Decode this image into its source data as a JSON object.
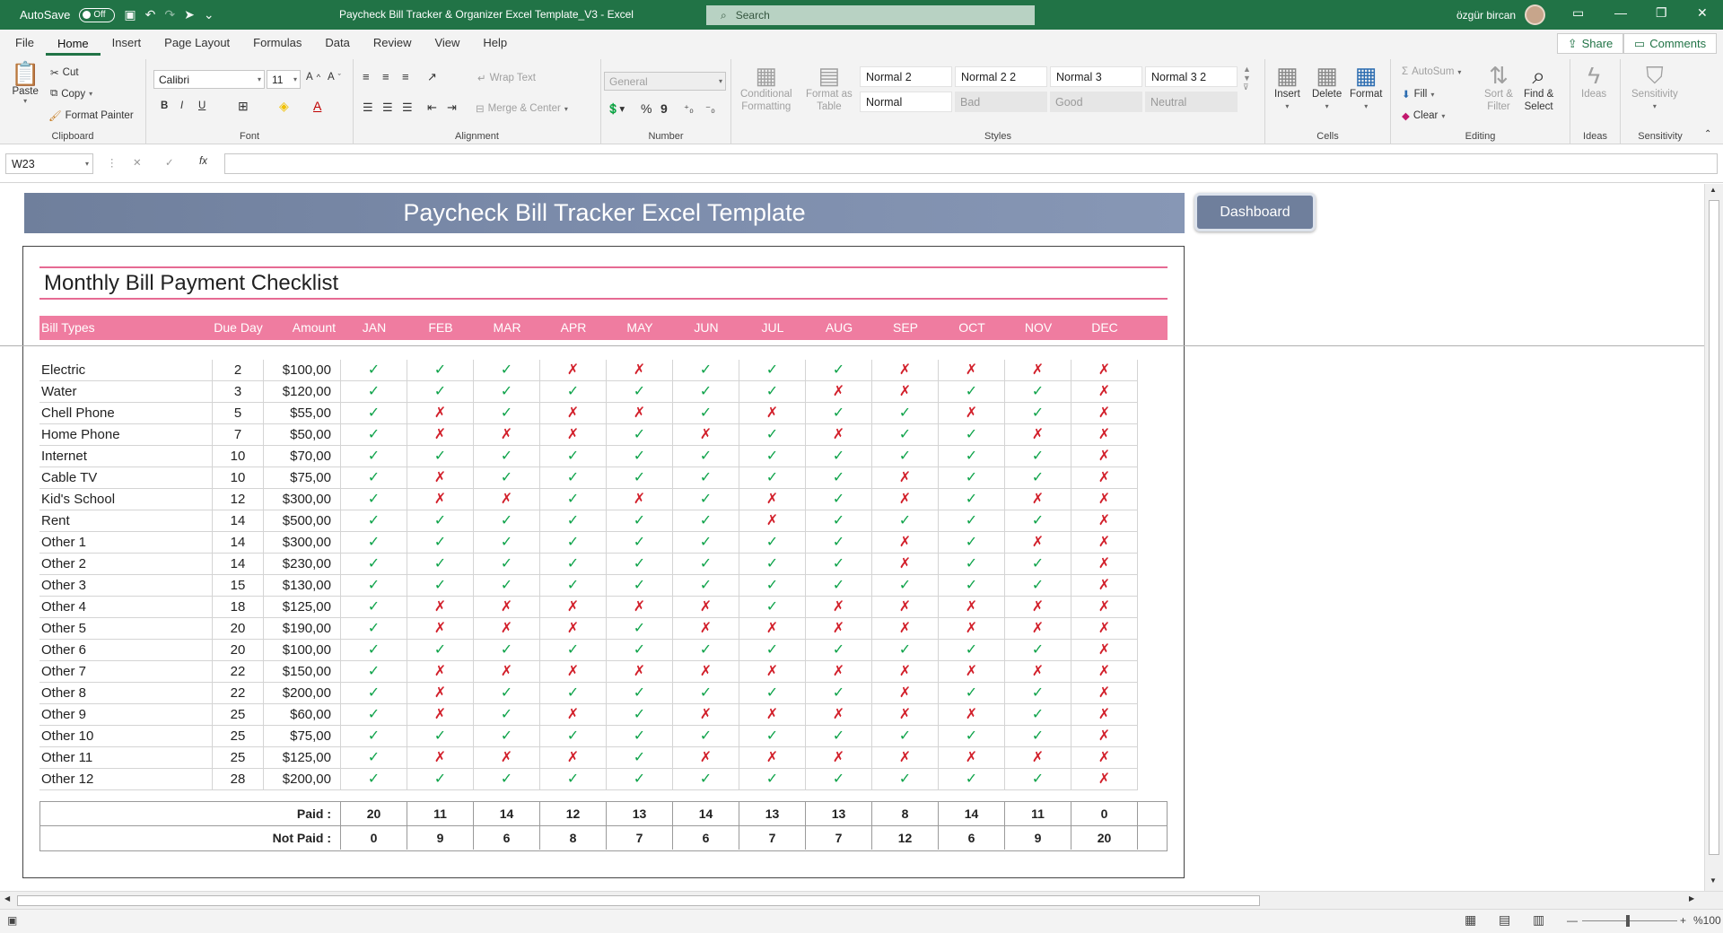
{
  "titlebar": {
    "autosave_label": "AutoSave",
    "autosave_state": "Off",
    "doc_title": "Paycheck Bill Tracker & Organizer Excel Template_V3  -  Excel",
    "search_placeholder": "Search",
    "user_name": "özgür bircan"
  },
  "menu": [
    "File",
    "Home",
    "Insert",
    "Page Layout",
    "Formulas",
    "Data",
    "Review",
    "View",
    "Help"
  ],
  "menu_active": "Home",
  "share_label": "Share",
  "comments_label": "Comments",
  "ribbon": {
    "clipboard": {
      "paste": "Paste",
      "cut": "Cut",
      "copy": "Copy",
      "format_painter": "Format Painter",
      "label": "Clipboard"
    },
    "font": {
      "name": "Calibri",
      "size": "11",
      "bold": "B",
      "italic": "I",
      "underline": "U",
      "label": "Font"
    },
    "alignment": {
      "wrap": "Wrap Text",
      "merge": "Merge & Center",
      "label": "Alignment"
    },
    "number": {
      "format": "General",
      "percent": "%",
      "comma": "9",
      "label": "Number"
    },
    "styles": {
      "conditional": "Conditional",
      "conditional2": "Formatting",
      "format_as": "Format as",
      "format_as2": "Table",
      "cells": [
        "Normal 2",
        "Normal 2 2",
        "Normal 3",
        "Normal 3 2",
        "Normal",
        "Bad",
        "Good",
        "Neutral"
      ],
      "label": "Styles"
    },
    "cells": {
      "insert": "Insert",
      "delete": "Delete",
      "format": "Format",
      "label": "Cells"
    },
    "editing": {
      "autosum": "AutoSum",
      "fill": "Fill",
      "clear": "Clear",
      "sort": "Sort &",
      "sort2": "Filter",
      "find": "Find &",
      "find2": "Select",
      "label": "Editing"
    },
    "ideas": {
      "ideas": "Ideas",
      "label": "Ideas"
    },
    "sensitivity": {
      "sensitivity": "Sensitivity",
      "label": "Sensitivity"
    }
  },
  "formula_bar": {
    "name_box": "W23",
    "fx": "fx",
    "value": ""
  },
  "sheet": {
    "banner_title": "Paycheck Bill Tracker Excel Template",
    "dashboard_label": "Dashboard",
    "card_title": "Monthly Bill Payment Checklist",
    "headers": [
      "Bill Types",
      "Due Day",
      "Amount",
      "JAN",
      "FEB",
      "MAR",
      "APR",
      "MAY",
      "JUN",
      "JUL",
      "AUG",
      "SEP",
      "OCT",
      "NOV",
      "DEC"
    ],
    "bills": [
      {
        "name": "Electric",
        "due": "2",
        "amount": "$100,00",
        "m": "YYYNNYYYNNNN"
      },
      {
        "name": "Water",
        "due": "3",
        "amount": "$120,00",
        "m": "YYYYYYYNNYYN"
      },
      {
        "name": "Chell Phone",
        "due": "5",
        "amount": "$55,00",
        "m": "YNYNNYNYYNYN"
      },
      {
        "name": "Home Phone",
        "due": "7",
        "amount": "$50,00",
        "m": "YNNNYNYNYYNN"
      },
      {
        "name": "Internet",
        "due": "10",
        "amount": "$70,00",
        "m": "YYYYYYYYYYYN"
      },
      {
        "name": "Cable TV",
        "due": "10",
        "amount": "$75,00",
        "m": "YNYYYYYYNYYN"
      },
      {
        "name": "Kid's School",
        "due": "12",
        "amount": "$300,00",
        "m": "YNNYNYNYNYNN"
      },
      {
        "name": "Rent",
        "due": "14",
        "amount": "$500,00",
        "m": "YYYYYYNYYYYN"
      },
      {
        "name": "Other 1",
        "due": "14",
        "amount": "$300,00",
        "m": "YYYYYYYYNYNN"
      },
      {
        "name": "Other 2",
        "due": "14",
        "amount": "$230,00",
        "m": "YYYYYYYYNYYN"
      },
      {
        "name": "Other 3",
        "due": "15",
        "amount": "$130,00",
        "m": "YYYYYYYYYYYN"
      },
      {
        "name": "Other 4",
        "due": "18",
        "amount": "$125,00",
        "m": "YNNNNNYNNNNN"
      },
      {
        "name": "Other 5",
        "due": "20",
        "amount": "$190,00",
        "m": "YNNNYNNNNNNN"
      },
      {
        "name": "Other 6",
        "due": "20",
        "amount": "$100,00",
        "m": "YYYYYYYYYYYN"
      },
      {
        "name": "Other 7",
        "due": "22",
        "amount": "$150,00",
        "m": "YNNNNNNNNNNN"
      },
      {
        "name": "Other 8",
        "due": "22",
        "amount": "$200,00",
        "m": "YNYYYYYYNYYN"
      },
      {
        "name": "Other 9",
        "due": "25",
        "amount": "$60,00",
        "m": "YNYNYNNNNNYN"
      },
      {
        "name": "Other 10",
        "due": "25",
        "amount": "$75,00",
        "m": "YYYYYYYYYYYN"
      },
      {
        "name": "Other 11",
        "due": "25",
        "amount": "$125,00",
        "m": "YNNNYNNNNNNN"
      },
      {
        "name": "Other 12",
        "due": "28",
        "amount": "$200,00",
        "m": "YYYYYYYYYYYN"
      }
    ],
    "paid_label": "Paid :",
    "notpaid_label": "Not Paid :",
    "paid": [
      "20",
      "11",
      "14",
      "12",
      "13",
      "14",
      "13",
      "13",
      "8",
      "14",
      "11",
      "0"
    ],
    "notpaid": [
      "0",
      "9",
      "6",
      "8",
      "7",
      "6",
      "7",
      "7",
      "12",
      "6",
      "9",
      "20"
    ]
  },
  "status": {
    "zoom": "%100"
  },
  "icons": {
    "check": "✓",
    "cross": "✗"
  },
  "colors": {
    "excel_green": "#217346",
    "header_pink": "#ef7ca0",
    "banner": "#7484a3",
    "check": "#0ea34a",
    "cross": "#d21f2a"
  }
}
